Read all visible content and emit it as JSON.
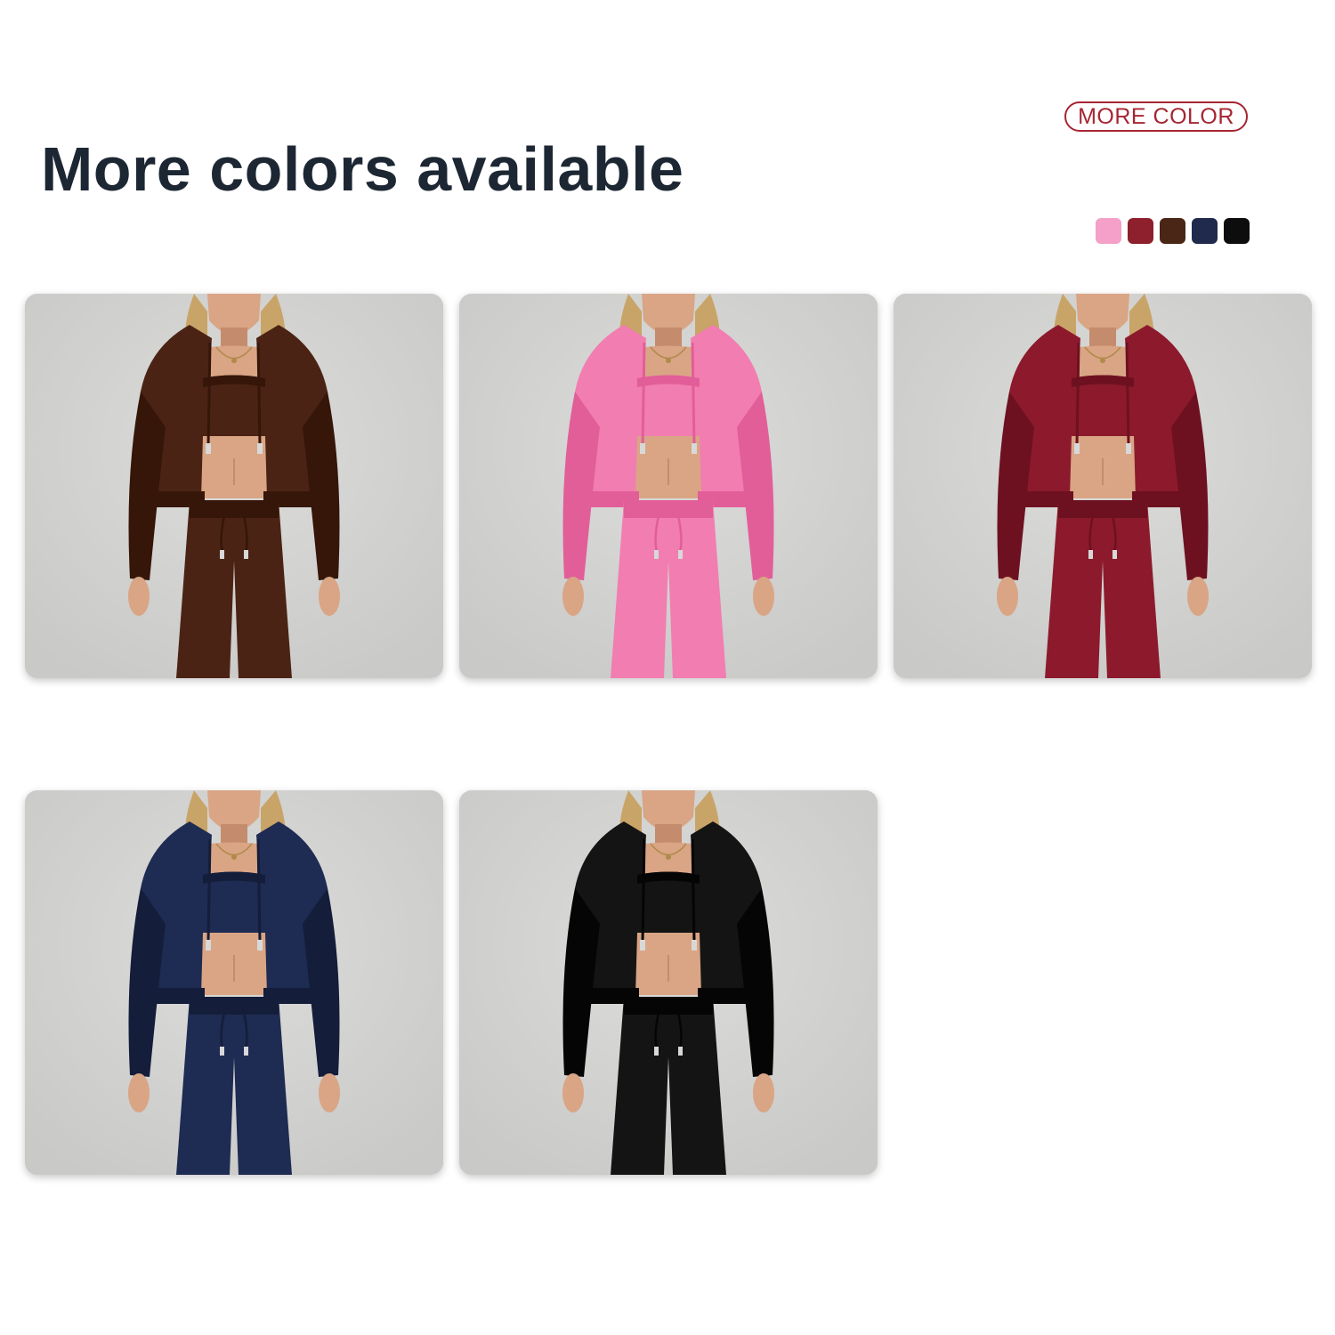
{
  "header": {
    "title": "More colors available",
    "badge_label": "MORE COLOR"
  },
  "swatches": [
    {
      "name": "pink",
      "color": "#f4a0c8"
    },
    {
      "name": "burgundy",
      "color": "#8e1f2c"
    },
    {
      "name": "brown",
      "color": "#4a2616"
    },
    {
      "name": "navy",
      "color": "#1f2a4d"
    },
    {
      "name": "black",
      "color": "#0d0d0d"
    }
  ],
  "products": [
    {
      "color_name": "brown",
      "garment": "#4b2314",
      "shade": "#351609"
    },
    {
      "color_name": "pink",
      "garment": "#f27db0",
      "shade": "#e25e98"
    },
    {
      "color_name": "burgundy",
      "garment": "#8c1a2c",
      "shade": "#6d1120"
    },
    {
      "color_name": "navy",
      "garment": "#1e2b52",
      "shade": "#141d3a"
    },
    {
      "color_name": "black",
      "garment": "#141414",
      "shade": "#050505"
    }
  ]
}
